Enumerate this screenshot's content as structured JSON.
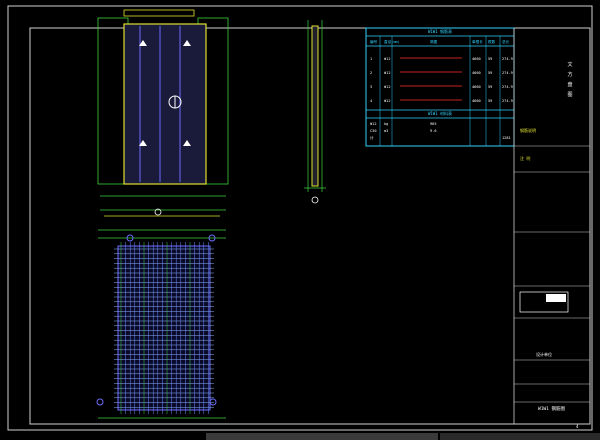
{
  "drawing": {
    "table_title": "W1W1 钢筋表",
    "table_header": [
      "编号",
      "直径(mm)",
      "简图",
      "单根长",
      "根数",
      "总长"
    ],
    "table_rows": [
      [
        "1",
        "Φ12",
        "",
        "4660",
        "59",
        "274.9"
      ],
      [
        "2",
        "Φ12",
        "",
        "4660",
        "59",
        "274.9"
      ],
      [
        "3",
        "Φ12",
        "",
        "4660",
        "59",
        "274.9"
      ],
      [
        "4",
        "Φ12",
        "",
        "4660",
        "59",
        "274.9"
      ]
    ],
    "summary_title": "W1W1 材料表",
    "summary_rows": [
      [
        "Φ12",
        "kg",
        "965",
        "",
        "",
        ""
      ],
      [
        "C30",
        "m3",
        "9.6",
        "",
        "",
        ""
      ],
      [
        "计",
        "",
        "",
        "",
        "",
        "1281"
      ]
    ],
    "notes_label": "钢筋说明",
    "notes_sub": "注 明",
    "title_vertical": [
      "文",
      "方",
      "盘",
      "图"
    ],
    "company": "设计单位",
    "project_title": "W1W1 钢筋图",
    "sheet_number": "4",
    "scale_label": "比例",
    "date_label": "日期",
    "bottom_tab": "Model"
  }
}
